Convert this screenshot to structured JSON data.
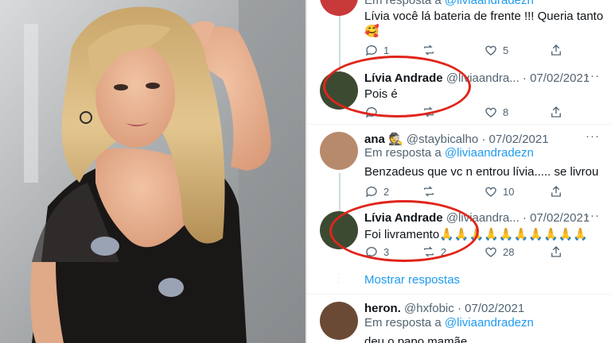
{
  "photo": {
    "alt": "Woman with wavy blonde hair in black sheer top"
  },
  "tweets": [
    {
      "reply_prefix": "Em resposta a",
      "reply_to": "@liviaandradezn",
      "text": "Lívia você lá bateria de frente !!! Queria tanto",
      "emoji": "🥰",
      "replies": "1",
      "retweets": "",
      "likes": "5"
    },
    {
      "name": "Lívia Andrade",
      "handle": "@liviaandra...",
      "date": "07/02/2021",
      "text": "Pois é",
      "replies": "",
      "retweets": "",
      "likes": "8"
    },
    {
      "name": "ana",
      "name_emoji": "🕵️",
      "handle": "@staybicalho",
      "date": "07/02/2021",
      "reply_prefix": "Em resposta a",
      "reply_to": "@liviaandradezn",
      "text": "Benzadeus que vc n entrou lívia..... se livrou",
      "replies": "2",
      "retweets": "",
      "likes": "10"
    },
    {
      "name": "Lívia Andrade",
      "handle": "@liviaandra...",
      "date": "07/02/2021",
      "text": "Foi livramento",
      "emoji": "🙏🙏🙏🙏🙏🙏🙏🙏🙏🙏",
      "replies": "3",
      "retweets": "2",
      "likes": "28"
    },
    {
      "name": "heron.",
      "handle": "@hxfobic",
      "date": "07/02/2021",
      "reply_prefix": "Em resposta a",
      "reply_to": "@liviaandradezn",
      "text": "deu o papo mamãe"
    }
  ],
  "show_replies": "Mostrar respostas",
  "more_icon": "···",
  "colors": {
    "mention": "#1d9bf0",
    "highlight": "#e0251b",
    "muted": "#536471"
  }
}
